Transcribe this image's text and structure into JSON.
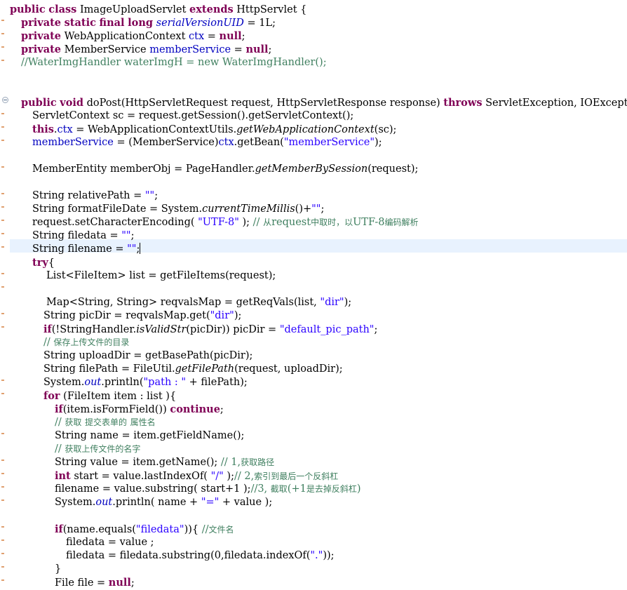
{
  "editor": {
    "file_code": [
      "public class ImageUploadServlet extends HttpServlet {",
      "private static final long serialVersionUID = 1L;",
      "private WebApplicationContext ctx = null;",
      "private MemberService memberService = null;",
      "//WaterImgHandler waterImgH = new WaterImgHandler();",
      "public void doPost(HttpServletRequest request, HttpServletResponse response) throws ServletException, IOException{",
      "ServletContext sc = request.getSession().getServletContext();",
      "this.ctx = WebApplicationContextUtils.getWebApplicationContext(sc);",
      "memberService = (MemberService)ctx.getBean(\"memberService\");",
      "MemberEntity memberObj = PageHandler.getMemberBySession(request);",
      "String relativePath = \"\";",
      "String formatFileDate = System.currentTimeMillis()+\"\";",
      "request.setCharacterEncoding( \"UTF-8\" ); // 从request中取时，以UTF-8编码解析",
      "String filedata = \"\";",
      "String filename = \"\";",
      "try{",
      "List<FileItem> list = getFileItems(request);",
      "Map<String, String> reqvalsMap = getReqVals(list, \"dir\");",
      "String picDir = reqvalsMap.get(\"dir\");",
      "if(!StringHandler.isValidStr(picDir)) picDir = \"default_pic_path\";",
      "// 保存上传文件的目录",
      "String uploadDir = getBasePath(picDir);",
      "String filePath = FileUtil.getFilePath(request, uploadDir);",
      "System.out.println(\"path : \" + filePath);",
      "for (FileItem item : list ){",
      "if(item.isFormField()) continue;",
      "// 获取 提交表单的 属性名",
      "String name = item.getFieldName();",
      "// 获取上传文件的名字",
      "String value = item.getName(); // 1,获取路径",
      "int start = value.lastIndexOf( \"/\" );// 2,索引到最后一个反斜杠",
      "filename = value.substring( start+1 );//3, 截取(+1是去掉反斜杠)",
      "System.out.println( name + \"=\" + value );",
      "if(name.equals(\"filedata\")){ //文件名",
      "filedata = value ;",
      "filedata = filedata.substring(0,filedata.indexOf(\".\"));",
      "}",
      "File file = null;"
    ]
  },
  "colors": {
    "keyword": "#7f0055",
    "field": "#0000c0",
    "string": "#2a00ff",
    "comment": "#3f7f5f",
    "current_line": "#e8f2fe"
  },
  "icons": [
    "fold-collapse-icon",
    "caret-cursor"
  ]
}
